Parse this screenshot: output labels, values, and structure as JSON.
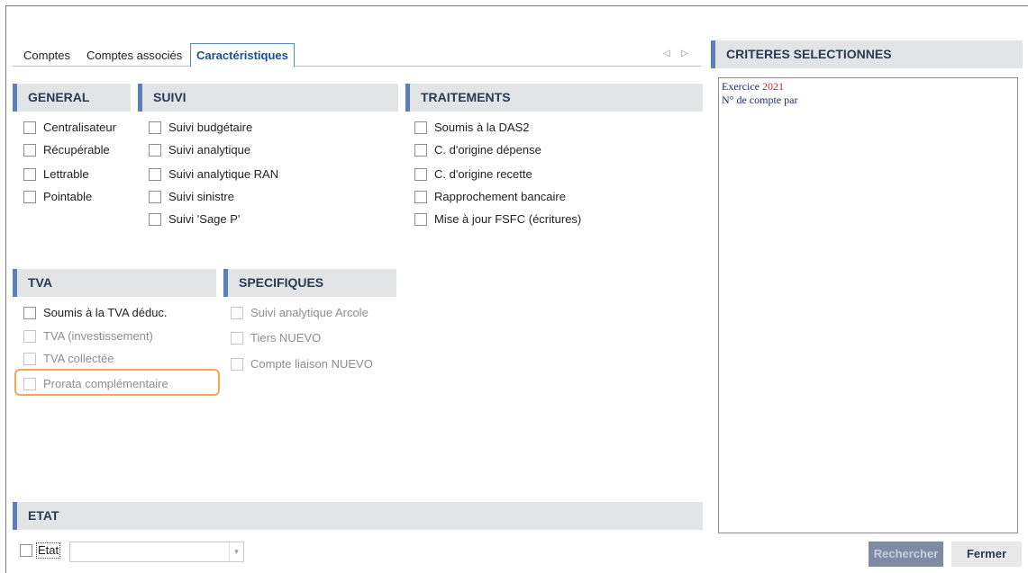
{
  "tabs": [
    {
      "label": "Comptes",
      "active": false
    },
    {
      "label": "Comptes associés",
      "active": false
    },
    {
      "label": "Caractéristiques",
      "active": true
    }
  ],
  "tab_scroll": {
    "prev_icon": "triangle-left-icon",
    "next_icon": "triangle-right-icon",
    "prev": "◁",
    "next": "▷"
  },
  "sections": {
    "general": {
      "title": "GENERAL",
      "items": [
        "Centralisateur",
        "Récupérable",
        "Lettrable",
        "Pointable"
      ]
    },
    "suivi": {
      "title": "SUIVI",
      "items": [
        "Suivi budgétaire",
        "Suivi analytique",
        "Suivi analytique RAN",
        "Suivi sinistre",
        "Suivi 'Sage P'"
      ]
    },
    "traitements": {
      "title": "TRAITEMENTS",
      "items": [
        "Soumis à la DAS2",
        "C. d'origine dépense",
        "C. d'origine recette",
        "Rapprochement bancaire",
        "Mise à jour FSFC (écritures)"
      ]
    },
    "tva": {
      "title": "TVA",
      "items": [
        "Soumis à la TVA déduc.",
        "TVA (investissement)",
        "TVA collectée",
        "Prorata complémentaire"
      ]
    },
    "specifiques": {
      "title": "SPECIFIQUES",
      "items": [
        "Suivi analytique Arcole",
        "Tiers NUEVO",
        "Compte liaison NUEVO"
      ]
    },
    "etat": {
      "title": "ETAT",
      "checkbox_label": "Etat",
      "combo_value": "",
      "combo_arrow": "▾"
    }
  },
  "criteria": {
    "title": "CRITERES SELECTIONNES",
    "line1_label": "Exercice",
    "line1_value": "2021",
    "line2": "N° de compte par"
  },
  "buttons": {
    "search": "Rechercher",
    "close": "Fermer"
  },
  "colors": {
    "accent": "#5b7fb6",
    "header_bg": "#e3e4e6",
    "highlight": "#f2a65a",
    "criteria_value": "#d0201b"
  }
}
